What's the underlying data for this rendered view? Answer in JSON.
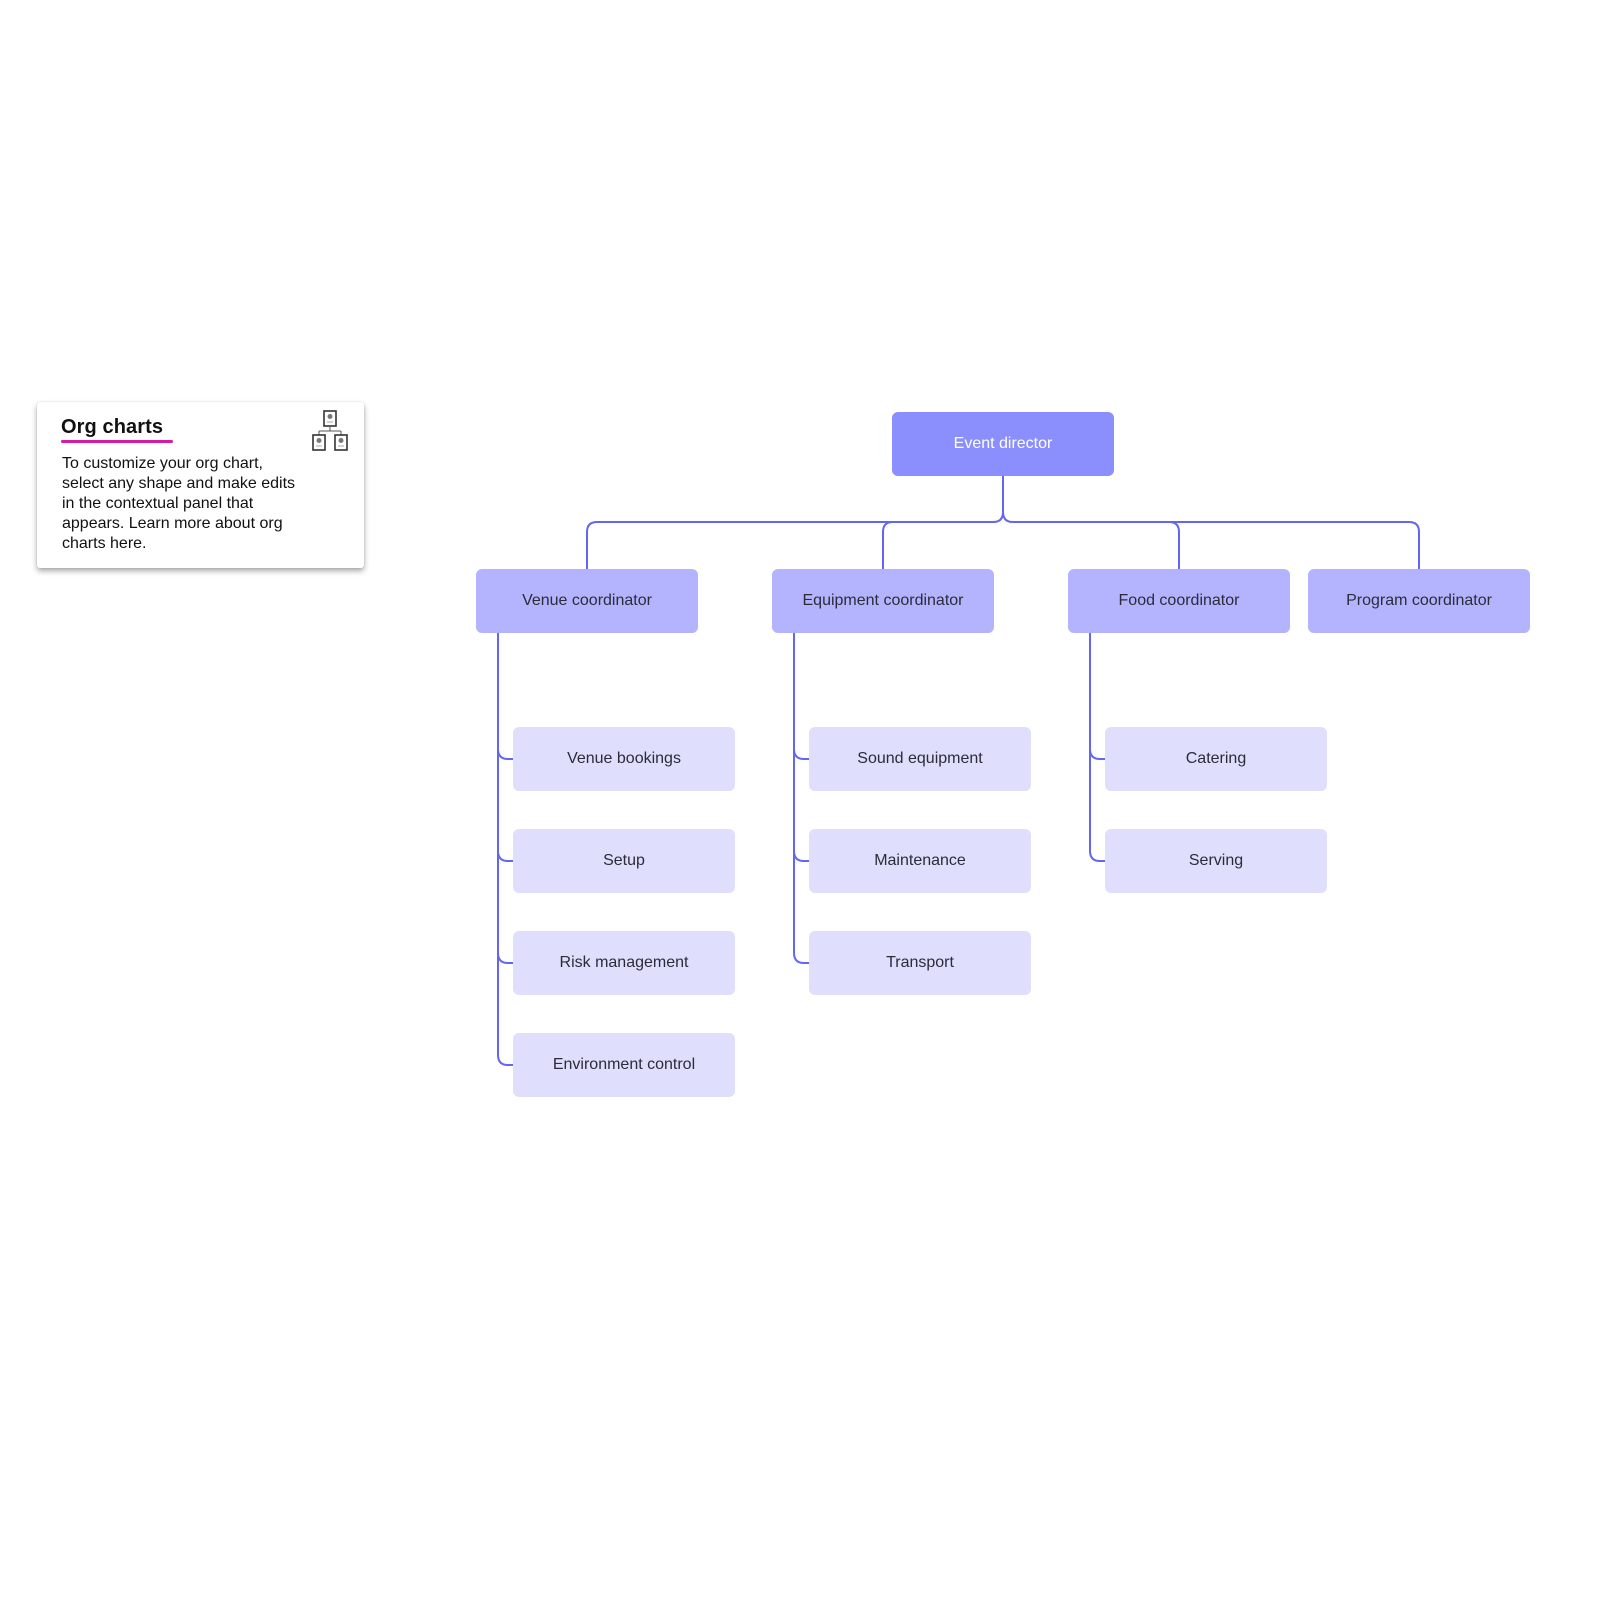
{
  "info_card": {
    "title": "Org charts",
    "body": "To customize your org chart, select any shape and make edits in the contextual panel that appears. Learn more about org charts here.",
    "icon": "org-chart-icon",
    "accent_color": "#d21ba6"
  },
  "org_chart": {
    "connector_color": "#6466f1",
    "root": {
      "label": "Event director",
      "color": "#8b8ffe"
    },
    "coordinators": [
      {
        "label": "Venue coordinator",
        "children": [
          "Venue bookings",
          "Setup",
          "Risk management",
          "Environment control"
        ]
      },
      {
        "label": "Equipment coordinator",
        "children": [
          "Sound equipment",
          "Maintenance",
          "Transport"
        ]
      },
      {
        "label": "Food coordinator",
        "children": [
          "Catering",
          "Serving"
        ]
      },
      {
        "label": "Program coordinator",
        "children": []
      }
    ],
    "level1_color": "#b3b4fd",
    "level2_color": "#dfdffd"
  }
}
